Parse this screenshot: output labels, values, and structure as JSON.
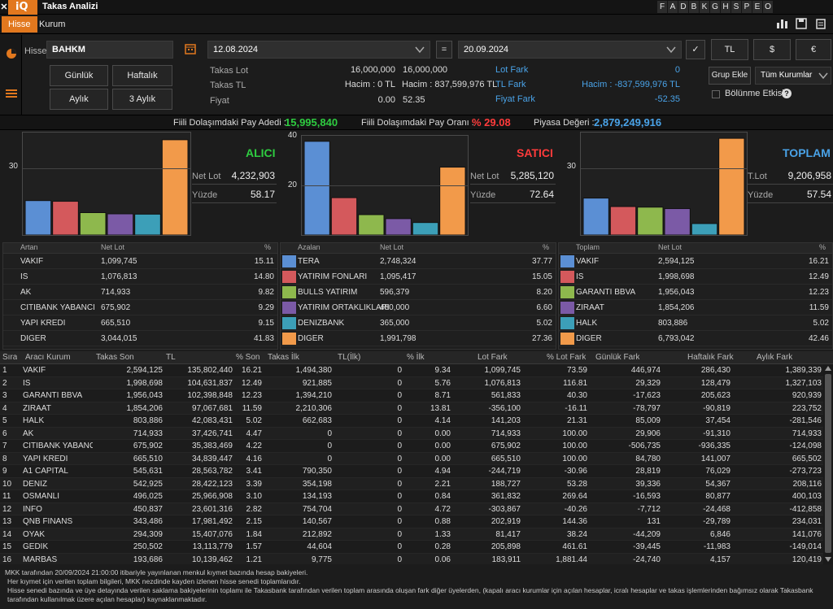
{
  "app": {
    "close_glyph": "✕",
    "logo": "iQ",
    "title": "Takas Analizi",
    "letters": [
      "F",
      "A",
      "D",
      "B",
      "K",
      "G",
      "H",
      "S",
      "P",
      "E",
      "O"
    ],
    "icons": [
      "bar-chart-icon",
      "save-icon",
      "clipboard-icon"
    ]
  },
  "tabs": [
    "Hisse",
    "Kurum"
  ],
  "form": {
    "hisse_label": "Hisse",
    "hisse_value": "BAHKM",
    "date_from": "12.08.2024",
    "date_to": "20.09.2024",
    "eq": "=",
    "check": "✓",
    "currency": [
      "TL",
      "$",
      "€"
    ],
    "period_buttons": [
      "Günlük",
      "Haftalık",
      "Aylık",
      "3 Aylık"
    ],
    "grup_ekle": "Grup Ekle",
    "kurum_select": "Tüm Kurumlar",
    "bolunme": "Bölünme Etkisi",
    "help": "?"
  },
  "stats": {
    "takas_lot_label": "Takas Lot",
    "takas_lot_1": "16,000,000",
    "takas_lot_2": "16,000,000",
    "takas_tl_label": "Takas TL",
    "takas_tl_1": "Hacim : 0 TL",
    "takas_tl_2": "Hacim : 837,599,976 TL",
    "fiyat_label": "Fiyat",
    "fiyat_1": "0.00",
    "fiyat_2": "52.35",
    "lot_fark_label": "Lot Fark",
    "lot_fark_val": "0",
    "tl_fark_label": "TL Fark",
    "tl_fark_val": "Hacim : -837,599,976 TL",
    "fiyat_fark_label": "Fiyat Fark",
    "fiyat_fark_val": "-52.35"
  },
  "status": {
    "pay_adedi_label": "Fiili Dolaşımdaki Pay Adedi :",
    "pay_adedi": "15,995,840",
    "pay_orani_label": "Fiili Dolaşımdaki Pay Oranı :",
    "pay_orani": "% 29.08",
    "piyasa_label": "Piyasa Değeri :",
    "piyasa": "2,879,249,916"
  },
  "colors": [
    "#5b8fd4",
    "#d4595c",
    "#8eb84d",
    "#7b5aa6",
    "#3c9fb8",
    "#f29a4a"
  ],
  "chart_data": [
    {
      "type": "bar",
      "title": "ALICI",
      "title_color": "#2ecc40",
      "ylim": [
        0,
        45
      ],
      "yticks": [
        30
      ],
      "values": [
        15.11,
        14.8,
        9.82,
        9.29,
        9.15,
        41.83
      ],
      "categories": [
        "VAKIF",
        "IS",
        "AK",
        "CITIBANK YABANCI",
        "YAPI KREDI",
        "DIGER"
      ]
    },
    {
      "type": "bar",
      "title": "SATICI",
      "title_color": "#ff3b3b",
      "ylim": [
        0,
        40
      ],
      "yticks": [
        20,
        40
      ],
      "values": [
        37.77,
        15.05,
        8.2,
        6.6,
        5.02,
        27.36
      ],
      "categories": [
        "TERA",
        "YATIRIM FONLARI",
        "BULLS YATIRIM",
        "YATIRIM ORTAKLIKLARI",
        "DENIZBANK",
        "DIGER"
      ]
    },
    {
      "type": "bar",
      "title": "TOPLAM",
      "title_color": "#4aa3e8",
      "ylim": [
        0,
        45
      ],
      "yticks": [
        30
      ],
      "values": [
        16.21,
        12.49,
        12.23,
        11.59,
        5.02,
        42.46
      ],
      "categories": [
        "VAKIF",
        "IS",
        "GARANTI BBVA",
        "ZIRAAT",
        "HALK",
        "DIGER"
      ]
    }
  ],
  "panels": [
    {
      "l1": "Net Lot",
      "v1": "4,232,903",
      "l2": "Yüzde",
      "v2": "58.17",
      "hdr": [
        "Artan",
        "Net Lot",
        "%"
      ],
      "rows": [
        [
          "VAKIF",
          "1,099,745",
          "15.11"
        ],
        [
          "IS",
          "1,076,813",
          "14.80"
        ],
        [
          "AK",
          "714,933",
          "9.82"
        ],
        [
          "CITIBANK YABANCI",
          "675,902",
          "9.29"
        ],
        [
          "YAPI KREDI",
          "665,510",
          "9.15"
        ],
        [
          "DIGER",
          "3,044,015",
          "41.83"
        ]
      ]
    },
    {
      "l1": "Net Lot",
      "v1": "5,285,120",
      "l2": "Yüzde",
      "v2": "72.64",
      "hdr": [
        "Azalan",
        "Net Lot",
        "%"
      ],
      "rows": [
        [
          "TERA",
          "2,748,324",
          "37.77"
        ],
        [
          "YATIRIM FONLARI",
          "1,095,417",
          "15.05"
        ],
        [
          "BULLS YATIRIM",
          "596,379",
          "8.20"
        ],
        [
          "YATIRIM ORTAKLIKLARI",
          "480,000",
          "6.60"
        ],
        [
          "DENIZBANK",
          "365,000",
          "5.02"
        ],
        [
          "DIGER",
          "1,991,798",
          "27.36"
        ]
      ]
    },
    {
      "l1": "T.Lot",
      "v1": "9,206,958",
      "l2": "Yüzde",
      "v2": "57.54",
      "hdr": [
        "Toplam",
        "Net Lot",
        "%"
      ],
      "rows": [
        [
          "VAKIF",
          "2,594,125",
          "16.21"
        ],
        [
          "IS",
          "1,998,698",
          "12.49"
        ],
        [
          "GARANTI BBVA",
          "1,956,043",
          "12.23"
        ],
        [
          "ZIRAAT",
          "1,854,206",
          "11.59"
        ],
        [
          "HALK",
          "803,886",
          "5.02"
        ],
        [
          "DIGER",
          "6,793,042",
          "42.46"
        ]
      ]
    }
  ],
  "table": {
    "headers": [
      "Sıra",
      "Aracı Kurum",
      "Takas Son",
      "TL",
      "% Son",
      "Takas İlk",
      "TL(İlk)",
      "% İlk",
      "Lot Fark",
      "% Lot Fark",
      "Günlük Fark",
      "Haftalık Fark",
      "Aylık Fark"
    ],
    "rows": [
      [
        "1",
        "VAKIF",
        "2,594,125",
        "135,802,440",
        "16.21",
        "1,494,380",
        "0",
        "9.34",
        "1,099,745",
        "73.59",
        "446,974",
        "286,430",
        "1,389,339"
      ],
      [
        "2",
        "IS",
        "1,998,698",
        "104,631,837",
        "12.49",
        "921,885",
        "0",
        "5.76",
        "1,076,813",
        "116.81",
        "29,329",
        "128,479",
        "1,327,103"
      ],
      [
        "3",
        "GARANTI BBVA",
        "1,956,043",
        "102,398,848",
        "12.23",
        "1,394,210",
        "0",
        "8.71",
        "561,833",
        "40.30",
        "-17,623",
        "205,623",
        "920,939"
      ],
      [
        "4",
        "ZIRAAT",
        "1,854,206",
        "97,067,681",
        "11.59",
        "2,210,306",
        "0",
        "13.81",
        "-356,100",
        "-16.11",
        "-78,797",
        "-90,819",
        "223,752"
      ],
      [
        "5",
        "HALK",
        "803,886",
        "42,083,431",
        "5.02",
        "662,683",
        "0",
        "4.14",
        "141,203",
        "21.31",
        "85,009",
        "37,454",
        "-281,546"
      ],
      [
        "6",
        "AK",
        "714,933",
        "37,426,741",
        "4.47",
        "0",
        "0",
        "0.00",
        "714,933",
        "100.00",
        "29,906",
        "-91,310",
        "714,933"
      ],
      [
        "7",
        "CITIBANK YABANCI",
        "675,902",
        "35,383,469",
        "4.22",
        "0",
        "0",
        "0.00",
        "675,902",
        "100.00",
        "-506,735",
        "-936,335",
        "-124,098"
      ],
      [
        "8",
        "YAPI KREDI",
        "665,510",
        "34,839,447",
        "4.16",
        "0",
        "0",
        "0.00",
        "665,510",
        "100.00",
        "84,780",
        "141,007",
        "665,502"
      ],
      [
        "9",
        "A1 CAPITAL",
        "545,631",
        "28,563,782",
        "3.41",
        "790,350",
        "0",
        "4.94",
        "-244,719",
        "-30.96",
        "28,819",
        "76,029",
        "-273,723"
      ],
      [
        "10",
        "DENIZ",
        "542,925",
        "28,422,123",
        "3.39",
        "354,198",
        "0",
        "2.21",
        "188,727",
        "53.28",
        "39,336",
        "54,367",
        "208,116"
      ],
      [
        "11",
        "OSMANLI",
        "496,025",
        "25,966,908",
        "3.10",
        "134,193",
        "0",
        "0.84",
        "361,832",
        "269.64",
        "-16,593",
        "80,877",
        "400,103"
      ],
      [
        "12",
        "INFO",
        "450,837",
        "23,601,316",
        "2.82",
        "754,704",
        "0",
        "4.72",
        "-303,867",
        "-40.26",
        "-7,712",
        "-24,468",
        "-412,858"
      ],
      [
        "13",
        "QNB FINANS",
        "343,486",
        "17,981,492",
        "2.15",
        "140,567",
        "0",
        "0.88",
        "202,919",
        "144.36",
        "131",
        "-29,789",
        "234,031"
      ],
      [
        "14",
        "OYAK",
        "294,309",
        "15,407,076",
        "1.84",
        "212,892",
        "0",
        "1.33",
        "81,417",
        "38.24",
        "-44,209",
        "6,846",
        "141,076"
      ],
      [
        "15",
        "GEDIK",
        "250,502",
        "13,113,779",
        "1.57",
        "44,604",
        "0",
        "0.28",
        "205,898",
        "461.61",
        "-39,445",
        "-11,983",
        "-149,014"
      ],
      [
        "16",
        "MARBAS",
        "193,686",
        "10,139,462",
        "1.21",
        "9,775",
        "0",
        "0.06",
        "183,911",
        "1,881.44",
        "-24,740",
        "4,157",
        "120,419"
      ]
    ]
  },
  "footer": [
    "MKK tarafından 20/09/2024 21:00:00 itibariyle yayınlanan menkul kıymet bazında hesap bakiyeleri.",
    "Her kıymet için verilen toplam bilgileri, MKK nezdinde kayden izlenen hisse senedi toplamlarıdır.",
    "Hisse senedi bazında ve üye detayında verilen saklama bakiyelerinin toplamı ile Takasbank tarafından verilen toplam arasında oluşan fark diğer üyelerden, (kapalı aracı kurumlar için açılan hesaplar, icralı hesaplar ve takas işlemlerinden bağımsız olarak Takasbank tarafından kullanılmak üzere açılan hesaplar) kaynaklanmaktadır."
  ]
}
